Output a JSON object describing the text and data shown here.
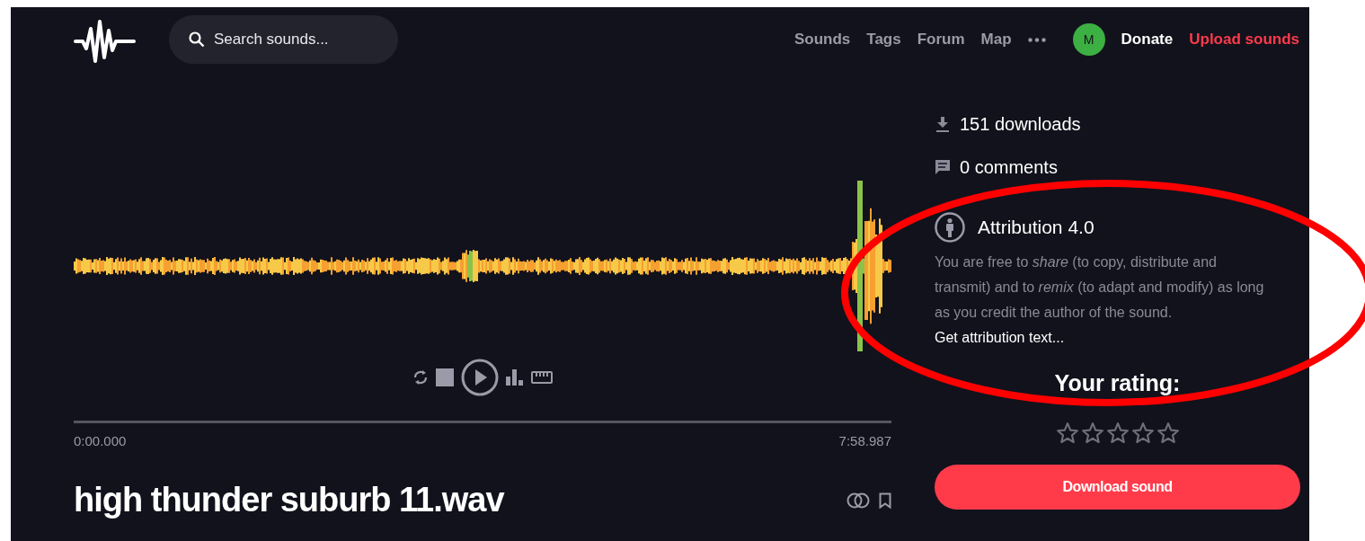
{
  "header": {
    "search": {
      "placeholder": "Search sounds..."
    },
    "nav": [
      {
        "label": "Sounds"
      },
      {
        "label": "Tags"
      },
      {
        "label": "Forum"
      },
      {
        "label": "Map"
      }
    ],
    "avatar": {
      "initial": "M"
    },
    "donate": "Donate",
    "upload": "Upload sounds"
  },
  "player": {
    "start_time": "0:00.000",
    "end_time": "7:58.987"
  },
  "sound": {
    "title": "high thunder suburb 11.wav"
  },
  "stats": [
    {
      "kind": "downloads",
      "label": "151 downloads"
    },
    {
      "kind": "comments",
      "label": "0 comments"
    }
  ],
  "license": {
    "title": "Attribution 4.0",
    "description": "You are free to *share* (to copy, distribute and transmit) and to *remix* (to adapt and modify) as long as you credit the author of the sound.",
    "link": "Get attribution text..."
  },
  "rating": {
    "label": "Your rating:",
    "stars": 0
  },
  "download_button": "Download sound",
  "annotation": {
    "kind": "ellipse"
  }
}
